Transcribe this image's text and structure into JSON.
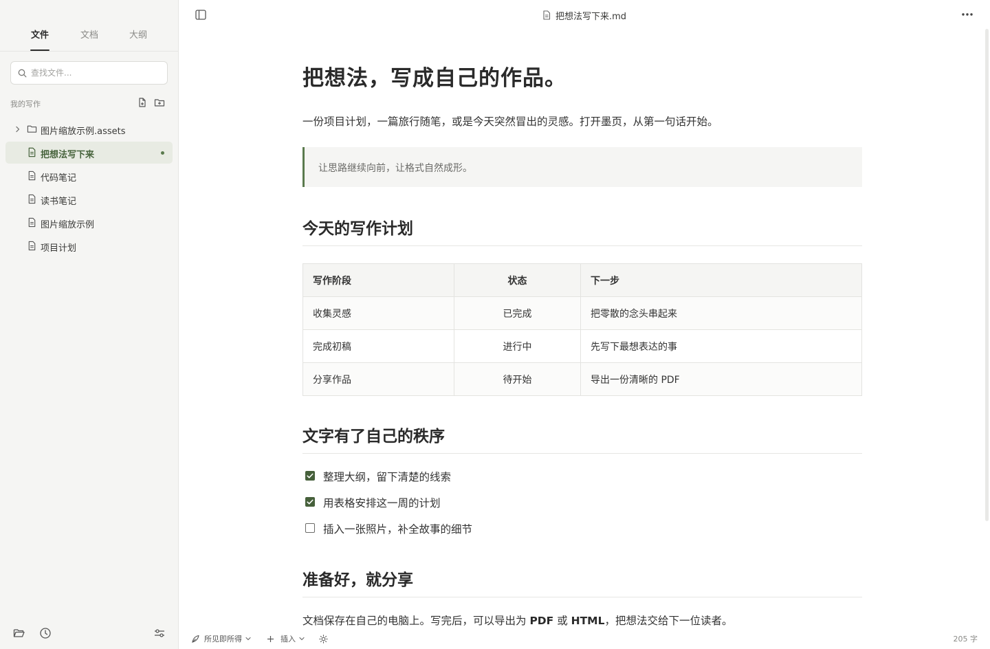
{
  "sidebar": {
    "tabs": [
      {
        "label": "文件"
      },
      {
        "label": "文档"
      },
      {
        "label": "大纲"
      }
    ],
    "search": {
      "placeholder": "查找文件..."
    },
    "section_title": "我的写作",
    "items": [
      {
        "label": "图片缩放示例.assets",
        "type": "folder"
      },
      {
        "label": "把想法写下来",
        "type": "file",
        "active": true
      },
      {
        "label": "代码笔记",
        "type": "file"
      },
      {
        "label": "读书笔记",
        "type": "file"
      },
      {
        "label": "图片缩放示例",
        "type": "file"
      },
      {
        "label": "项目计划",
        "type": "file"
      }
    ]
  },
  "topbar": {
    "doc_title": "把想法写下来.md"
  },
  "doc": {
    "h1": "把想法，写成自己的作品。",
    "lead": "一份项目计划，一篇旅行随笔，或是今天突然冒出的灵感。打开墨页，从第一句话开始。",
    "quote": "让思路继续向前，让格式自然成形。",
    "h2_plan": "今天的写作计划",
    "table": {
      "headers": [
        "写作阶段",
        "状态",
        "下一步"
      ],
      "rows": [
        [
          "收集灵感",
          "已完成",
          "把零散的念头串起来"
        ],
        [
          "完成初稿",
          "进行中",
          "先写下最想表达的事"
        ],
        [
          "分享作品",
          "待开始",
          "导出一份清晰的 PDF"
        ]
      ]
    },
    "h2_order": "文字有了自己的秩序",
    "tasks": [
      {
        "text": "整理大纲，留下清楚的线索",
        "checked": true
      },
      {
        "text": "用表格安排这一周的计划",
        "checked": true
      },
      {
        "text": "插入一张照片，补全故事的细节",
        "checked": false
      }
    ],
    "h2_share": "准备好，就分享",
    "final": {
      "p1": "文档保存在自己的电脑上。写完后，可以导出为 ",
      "b1": "PDF",
      "p2": " 或 ",
      "b2": "HTML",
      "p3": "，把想法交给下一位读者。"
    }
  },
  "statusbar": {
    "mode": "所见即所得",
    "insert": "插入",
    "word_count": "205 字"
  },
  "colors": {
    "accent": "#5a7a4d",
    "accent_dark": "#46603b",
    "sidebar_bg": "#f5f5f3",
    "active_item_bg": "#e8ebe3"
  }
}
